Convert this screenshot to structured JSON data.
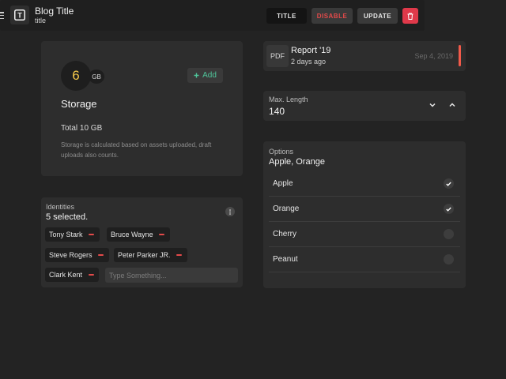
{
  "storage": {
    "size_value": "6",
    "size_unit": "GB",
    "add_label": "Add",
    "title": "Storage",
    "total": "Total 10 GB",
    "description": "Storage is calculated based on assets uploaded, draft uploads also counts.",
    "colors": {
      "accent": "#4fc59a",
      "size": "#f4c84a"
    }
  },
  "report": {
    "badge": "PDF",
    "title": "Report '19",
    "subtitle": "2 days ago",
    "date": "Sep 4, 2019",
    "indicator_color": "#f15a4a"
  },
  "max_length": {
    "label": "Max. Length",
    "value": "140"
  },
  "options": {
    "label": "Options",
    "value": "Apple, Orange",
    "items": [
      {
        "label": "Apple",
        "checked": true
      },
      {
        "label": "Orange",
        "checked": true
      },
      {
        "label": "Cherry",
        "checked": false
      },
      {
        "label": "Peanut",
        "checked": false
      }
    ]
  },
  "identities": {
    "label": "Identities",
    "count": "5 selected.",
    "chips": [
      "Tony Stark",
      "Bruce Wayne",
      "Steve Rogers",
      "Peter Parker JR.",
      "Clark Kent"
    ],
    "input_placeholder": "Type Something...",
    "remove_color": "#e34a4a"
  },
  "blog": {
    "icon_letter": "T",
    "title": "Blog Title",
    "subtitle": "title",
    "buttons": {
      "title": "TITLE",
      "disable": "DISABLE",
      "update": "UPDATE"
    },
    "delete_color": "#e0394a"
  }
}
